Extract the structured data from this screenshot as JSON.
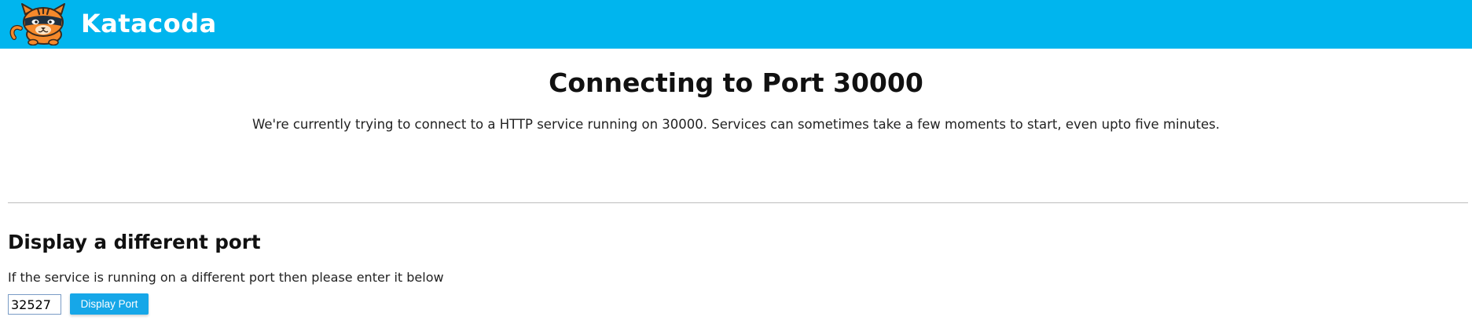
{
  "header": {
    "brand_name": "Katacoda",
    "logo_icon": "cat-mascot-icon",
    "background_color": "#00b5ee"
  },
  "main": {
    "title": "Connecting to Port 30000",
    "description": "We're currently trying to connect to a HTTP service running on 30000. Services can sometimes take a few moments to start, even upto five minutes."
  },
  "port_section": {
    "title": "Display a different port",
    "description": "If the service is running on a different port then please enter it below",
    "input_value": "32527",
    "button_label": "Display Port",
    "button_color": "#16a7e8"
  }
}
